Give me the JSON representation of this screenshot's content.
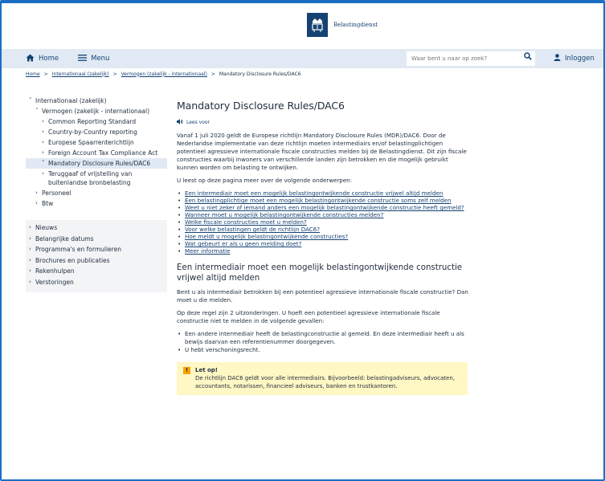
{
  "header": {
    "brand": "Belastingdienst",
    "emblem": "crown-emblem"
  },
  "nav": {
    "home": "Home",
    "menu": "Menu",
    "search_placeholder": "Waar bent u naar op zoek?",
    "login": "Inloggen"
  },
  "breadcrumb": {
    "items": [
      "Home",
      "Internationaal (zakelijk)",
      "Vermogen (zakelijk - internationaal)"
    ],
    "current": "Mandatory Disclosure Rules/DAC6",
    "separator": ">"
  },
  "sidebar": {
    "tree": [
      {
        "label": "Internationaal (zakelijk)",
        "chevron": "v",
        "level": 0
      },
      {
        "label": "Vermogen (zakelijk - internationaal)",
        "chevron": "v",
        "level": 1
      },
      {
        "label": "Common Reporting Standard",
        "chevron": ">",
        "level": 2
      },
      {
        "label": "Country-by-Country reporting",
        "chevron": ">",
        "level": 2
      },
      {
        "label": "Europese Spaarrenterichtlijn",
        "chevron": ">",
        "level": 2
      },
      {
        "label": "Foreign Account Tax Compliance Act",
        "chevron": ">",
        "level": 2
      },
      {
        "label": "Mandatory Disclosure Rules/DAC6",
        "chevron": "v",
        "level": 2,
        "active": true
      },
      {
        "label": "Teruggaaf of vrijstelling van buitenlandse bronbelasting",
        "chevron": ">",
        "level": 2
      },
      {
        "label": "Personeel",
        "chevron": ">",
        "level": 1
      },
      {
        "label": "Btw",
        "chevron": ">",
        "level": 1
      }
    ],
    "sections": [
      "Nieuws",
      "Belangrijke datums",
      "Programma's en formulieren",
      "Brochures en publicaties",
      "Rekenhulpen",
      "Verstoringen"
    ]
  },
  "main": {
    "title": "Mandatory Disclosure Rules/DAC6",
    "read_aloud": "Lees voor",
    "intro": "Vanaf 1 juli 2020 geldt de Europese richtlijn Mandatory Disclosure Rules (MDR)/DAC6. Door de Nederlandse implementatie van deze richtlijn moeten intermediairs en/of belastingplichtigen potentieel agressieve internationale fiscale constructies melden bij de Belastingdienst. Dit zijn fiscale constructies waarbij inwoners van verschillende landen zijn betrokken en die mogelijk gebruikt kunnen worden om belasting te ontwijken.",
    "topics_intro": "U leest op deze pagina meer over de volgende onderwerpen:",
    "topics": [
      "Een intermediair moet een mogelijk belastingontwijkende constructie vrijwel altijd melden",
      "Een belastingplichtige moet een mogelijk belastingontwijkende constructie soms zelf melden",
      "Weet u niet zeker of iemand anders een mogelijk belastingontwijkende constructie heeft gemeld?",
      "Wanneer moet u mogelijk belastingontwijkende constructies melden?",
      "Welke fiscale constructies moet u melden?",
      "Voor welke belastingen geldt de richtlijn DAC6?",
      "Hoe meldt u mogelijk belastingontwijkende constructies?",
      "Wat gebeurt er als u geen melding doet?",
      "Meer informatie"
    ],
    "section_title": "Een intermediair moet een mogelijk belastingontwijkende constructie vrijwel altijd melden",
    "section_p1": "Bent u als intermediair betrokken bij een potentieel agressieve internationale fiscale constructie? Dan moet u die melden.",
    "section_p2": "Op deze regel zijn 2 uitzonderingen. U hoeft een potentieel agressieve internationale fiscale constructie niet te melden in de volgende gevallen:",
    "exceptions": [
      "Een andere intermediair heeft de belastingconstructie al gemeld. En deze intermediair heeft u als bewijs daarvan een referentienummer doorgegeven.",
      "U hebt verschoningsrecht."
    ],
    "notice": {
      "icon": "!",
      "title": "Let op!",
      "text": "De richtlijn DAC6 geldt voor alle intermediairs. Bijvoorbeeld: belastingadviseurs, advocaten, accountants, notarissen, financieel adviseurs, banken en trustkantoren."
    }
  }
}
